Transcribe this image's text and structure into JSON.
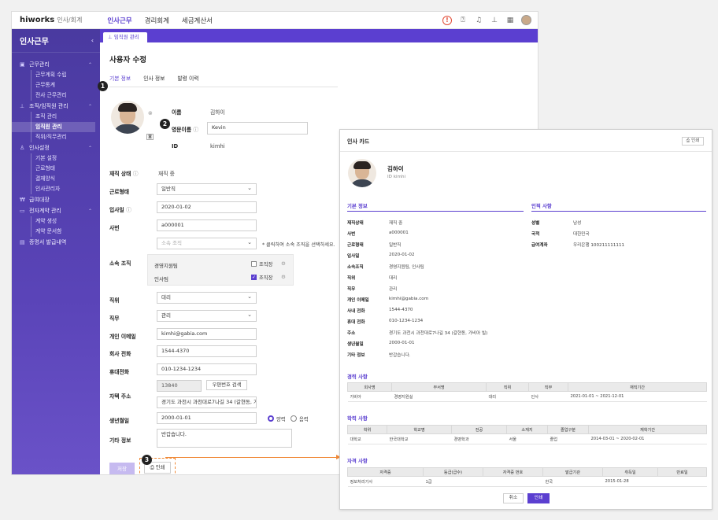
{
  "topbar": {
    "logo": "hiworks",
    "logo_sub": "인사/회계",
    "nav": [
      "인사근무",
      "경리회계",
      "세금계산서"
    ]
  },
  "sidebar": {
    "title": "인사근무",
    "groups": [
      {
        "label": "근무관리",
        "items": [
          "근무계획 수립",
          "근무통계",
          "전사 근무관리"
        ]
      },
      {
        "label": "조직/임직원 관리",
        "items": [
          "조직 관리",
          "임직원 관리",
          "직위/직무관리"
        ]
      },
      {
        "label": "인사설정",
        "items": [
          "기본 설정",
          "근로형태",
          "결재양식",
          "인사관리자"
        ]
      },
      {
        "label": "급여대장",
        "items": []
      },
      {
        "label": "전자계약 관리",
        "items": [
          "계약 생성",
          "계약 문서함"
        ]
      },
      {
        "label": "증명서 발급내역",
        "items": []
      }
    ],
    "active_item": "임직원 관리"
  },
  "tab": {
    "label": "임직원 관리"
  },
  "page": {
    "title": "사용자 수정",
    "subtabs": [
      "기본 정보",
      "인사 정보",
      "발령 이력"
    ],
    "badges": [
      "1",
      "2",
      "3"
    ]
  },
  "form": {
    "name_label": "이름",
    "name_value": "김하이",
    "eng_label": "영문이름",
    "eng_value": "Kevin",
    "id_label": "ID",
    "id_value": "kimhi",
    "status_label": "재직 상태",
    "status_value": "재직 중",
    "worktype_label": "근로형태",
    "worktype_value": "일반직",
    "joindate_label": "입사일",
    "joindate_value": "2020-01-02",
    "empno_label": "사번",
    "empno_value": "a000001",
    "org_label": "소속 조직",
    "org_placeholder": "소속 조직",
    "org_hint": "* 클릭하여 소속 조직을 선택하세요.",
    "orgs": [
      {
        "name": "경영지원팀",
        "head_label": "조직장",
        "checked": false
      },
      {
        "name": "인사팀",
        "head_label": "조직장",
        "checked": true
      }
    ],
    "position_label": "직위",
    "position_value": "대리",
    "duty_label": "직무",
    "duty_value": "관리",
    "email_label": "개인 이메일",
    "email_value": "kimhi@gabia.com",
    "office_label": "회사 전화",
    "office_value": "1544-4370",
    "mobile_label": "휴대전화",
    "mobile_value": "010-1234-1234",
    "address_label": "자택 주소",
    "zip_value": "13840",
    "zip_button": "우편번호 검색",
    "address_value": "경기도 과천시 과천대로7나길 34 (갈현동, 가",
    "birth_label": "생년월일",
    "birth_value": "2000-01-01",
    "solar_label": "양력",
    "lunar_label": "음력",
    "etc_label": "기타 정보",
    "etc_value": "반갑습니다.",
    "save_button": "저장",
    "print_button": "인쇄"
  },
  "card": {
    "title": "인사 카드",
    "print_button": "인쇄",
    "name": "김하이",
    "id": "ID kimhi",
    "basic_title": "기본 정보",
    "basic": [
      {
        "k": "재직상태",
        "v": "재직 중"
      },
      {
        "k": "사번",
        "v": "a000001"
      },
      {
        "k": "근로형태",
        "v": "일반직"
      },
      {
        "k": "입사일",
        "v": "2020-01-02"
      },
      {
        "k": "소속조직",
        "v": "경영지원팀, 인사팀"
      },
      {
        "k": "직위",
        "v": "대리"
      },
      {
        "k": "직무",
        "v": "관리"
      },
      {
        "k": "개인 이메일",
        "v": "kimhi@gabia.com"
      },
      {
        "k": "사내 전화",
        "v": "1544-4370"
      },
      {
        "k": "휴대 전화",
        "v": "010-1234-1234"
      },
      {
        "k": "주소",
        "v": "경기도 과천시 과천대로7나길 34 (갈현동, 가비아 빌)"
      },
      {
        "k": "생년월일",
        "v": "2000-01-01"
      },
      {
        "k": "기타 정보",
        "v": "반갑습니다."
      }
    ],
    "personal_title": "인적 사항",
    "personal": [
      {
        "k": "성별",
        "v": "남성"
      },
      {
        "k": "국적",
        "v": "대한민국"
      },
      {
        "k": "급여계좌",
        "v": "우리은행 100211111111"
      }
    ],
    "career_title": "경력 사항",
    "career_headers": [
      "회사명",
      "부서명",
      "직위",
      "직무",
      "재직기간"
    ],
    "career_rows": [
      [
        "가비아",
        "경영지원실",
        "대리",
        "인사",
        "2021-01-01 ~ 2021-12-01"
      ]
    ],
    "edu_title": "학력 사항",
    "edu_headers": [
      "학위",
      "학교명",
      "전공",
      "소재지",
      "졸업구분",
      "재학기간"
    ],
    "edu_rows": [
      [
        "대학교",
        "한국대학교",
        "경영학과",
        "서울",
        "졸업",
        "2014-03-01 ~ 2020-02-01"
      ]
    ],
    "cert_title": "자격 사항",
    "cert_headers": [
      "자격증",
      "등급(급수)",
      "자격증 번호",
      "발급기관",
      "취득일",
      "만료일"
    ],
    "cert_rows": [
      [
        "정보처리기사",
        "1급",
        "",
        "한국",
        "2015-01-28",
        ""
      ]
    ],
    "cancel_button": "취소",
    "confirm_button": "인쇄"
  }
}
